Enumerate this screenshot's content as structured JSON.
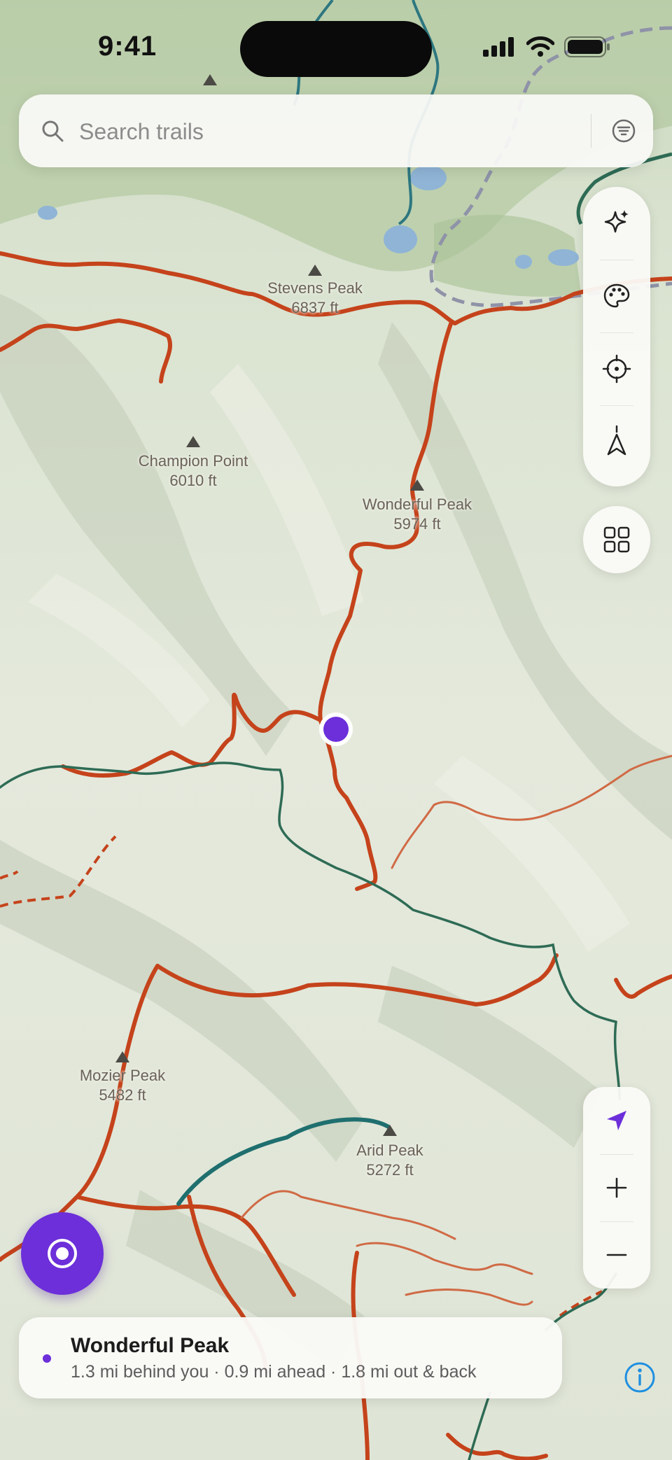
{
  "status_bar": {
    "time": "9:41"
  },
  "search": {
    "placeholder": "Search trails",
    "value": ""
  },
  "peaks": [
    {
      "name": "Stevens Peak",
      "elevation": "6837 ft"
    },
    {
      "name": "Champion Point",
      "elevation": "6010 ft"
    },
    {
      "name": "Wonderful Peak",
      "elevation": "5974 ft"
    },
    {
      "name": "Mozier Peak",
      "elevation": "5482 ft"
    },
    {
      "name": "Arid Peak",
      "elevation": "5272 ft"
    }
  ],
  "toolbar": {
    "icons": [
      "sparkle-icon",
      "palette-icon",
      "crosshair-icon",
      "compass-arrow-icon"
    ],
    "layers_icon": "grid-icon",
    "zoom_icons": [
      "navigation-arrow-icon",
      "plus-icon",
      "minus-icon"
    ]
  },
  "selected_trail": {
    "name": "Wonderful Peak",
    "summary": "1.3 mi behind you · 0.9 mi ahead · 1.8 mi out & back"
  },
  "colors": {
    "accent": "#6c2fd9",
    "trail": "#c5431b",
    "trail_secondary": "#d06a45",
    "path_green": "#2e6b55",
    "boundary": "#8f93a8",
    "water": "#8fb4d6",
    "info_blue": "#1f8fe0"
  }
}
